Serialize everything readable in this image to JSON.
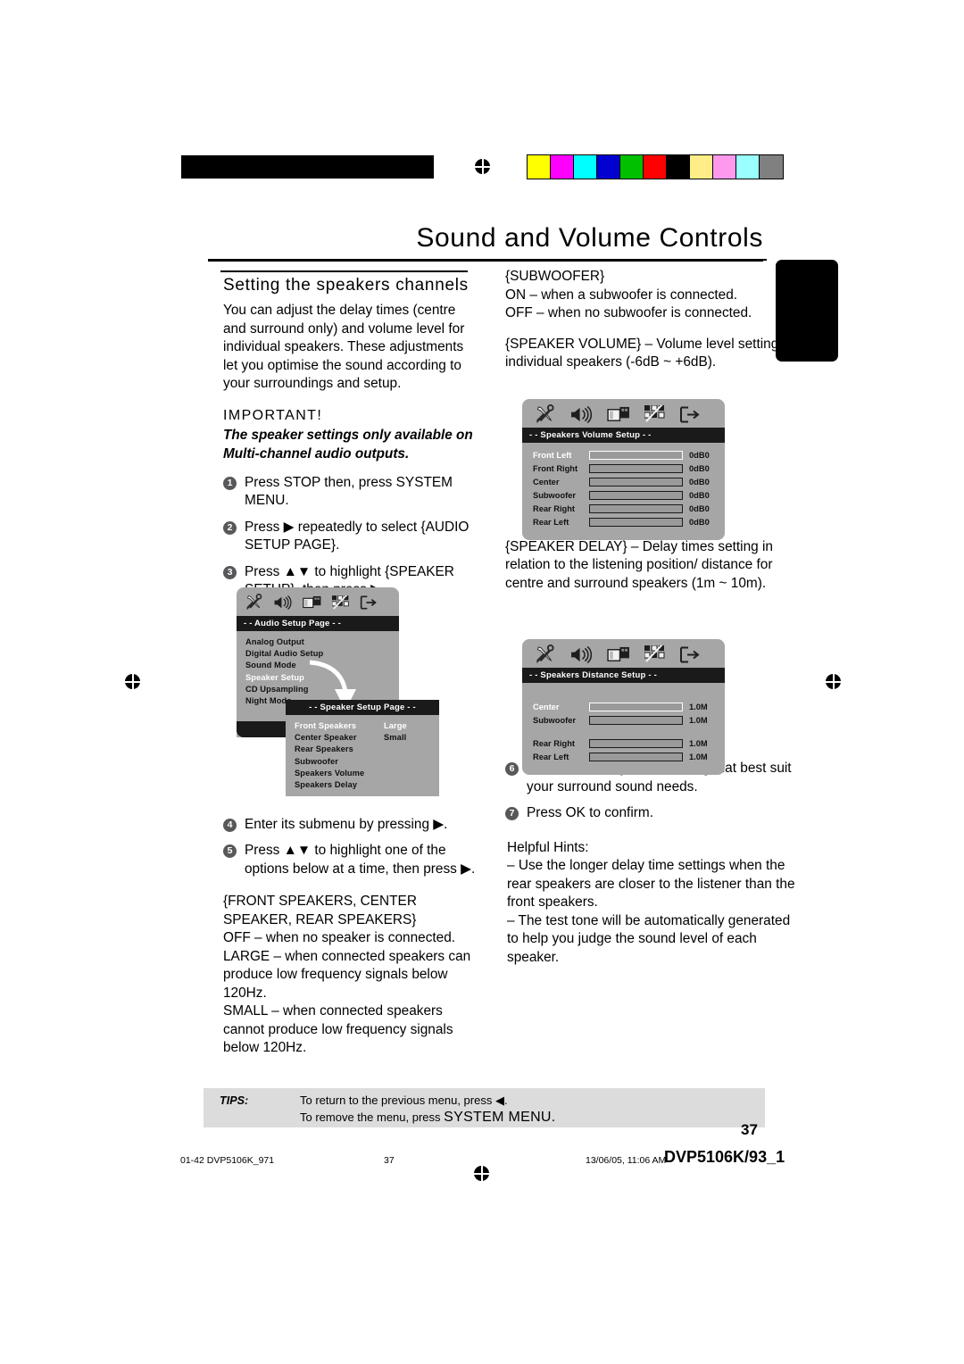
{
  "print_marks": {
    "color_bar": [
      "#ffff00",
      "#ff00ff",
      "#00ffff",
      "#0000d0",
      "#00c000",
      "#ff0000",
      "#000000",
      "#ffee88",
      "#ff99ee",
      "#99ffff",
      "#808080"
    ],
    "registration_icon": "registration-target-icon"
  },
  "header": {
    "title": "Sound and Volume Controls"
  },
  "left_column": {
    "section_heading": "Setting the speakers channels",
    "intro": "You can adjust the delay times (centre and surround only) and volume level for individual speakers. These adjustments let you optimise the sound according to your surroundings and setup.",
    "important_heading": "IMPORTANT!",
    "important_body": "The speaker settings only available on Multi-channel audio outputs.",
    "steps": [
      {
        "num": "1",
        "text": "Press STOP then, press SYSTEM MENU."
      },
      {
        "num": "2",
        "text": "Press ▶ repeatedly to select {AUDIO SETUP PAGE}."
      },
      {
        "num": "3",
        "text": "Press ▲▼ to highlight {SPEAKER SETUP}, then press ▶."
      },
      {
        "num": "4",
        "text": "Enter its submenu by pressing ▶."
      },
      {
        "num": "5",
        "text": "Press ▲▼ to highlight one of the options below at a time, then press ▶."
      }
    ],
    "speakers_heading": "{FRONT SPEAKERS, CENTER SPEAKER, REAR SPEAKERS}",
    "speakers_off": "OFF – when no speaker is connected.",
    "speakers_large": "LARGE – when connected speakers can produce low frequency signals below 120Hz.",
    "speakers_small": "SMALL – when connected speakers cannot produce low frequency signals below 120Hz."
  },
  "right_column": {
    "subwoofer_heading": "{SUBWOOFER}",
    "subwoofer_on": "ON – when a subwoofer is connected.",
    "subwoofer_off": "OFF – when no subwoofer is connected.",
    "speaker_volume": "{SPEAKER VOLUME} – Volume level setting for individual speakers (-6dB ~ +6dB).",
    "speaker_delay": "{SPEAKER DELAY} – Delay times setting in relation to the listening position/ distance for centre and surround speakers (1m ~ 10m).",
    "steps": [
      {
        "num": "6",
        "text": "Press ◀▶ to adjust the setting that best suit your surround sound needs."
      },
      {
        "num": "7",
        "text": "Press OK to confirm."
      }
    ],
    "hints_heading": "Helpful Hints:",
    "hint_1": "–    Use the longer delay time settings when the rear speakers are closer to the listener than the front speakers.",
    "hint_2": "–    The test tone will be automatically generated to help you judge the sound level of each speaker."
  },
  "osd": {
    "icons": [
      "tools-icon",
      "speaker-icon",
      "video-icon",
      "preference-icon",
      "exit-icon"
    ],
    "audio_setup": {
      "title": "- -  Audio Setup Page  - -",
      "items": [
        "Analog Output",
        "Digital Audio Setup",
        "Sound Mode",
        "Speaker Setup",
        "CD Upsampling",
        "Night Mode"
      ],
      "highlighted": "Speaker Setup"
    },
    "speaker_setup": {
      "title": "- -   Speaker Setup Page   - -",
      "items": [
        "Front Speakers",
        "Center Speaker",
        "Rear Speakers",
        "Subwoofer",
        "Speakers Volume",
        "Speakers Delay"
      ],
      "highlighted": "Front Speakers",
      "values": [
        "Large",
        "Small"
      ],
      "highlighted_value": "Large"
    },
    "volume_setup": {
      "title": "- - Speakers Volume Setup - -",
      "rows": [
        {
          "label": "Front Left",
          "fill": 48,
          "value": "0dB0",
          "highlighted": true
        },
        {
          "label": "Front Right",
          "fill": 48,
          "value": "0dB0",
          "highlighted": false
        },
        {
          "label": "Center",
          "fill": 48,
          "value": "0dB0",
          "highlighted": false
        },
        {
          "label": "Subwoofer",
          "fill": 48,
          "value": "0dB0",
          "highlighted": false
        },
        {
          "label": "Rear Right",
          "fill": 48,
          "value": "0dB0",
          "highlighted": false
        },
        {
          "label": "Rear Left",
          "fill": 48,
          "value": "0dB0",
          "highlighted": false
        }
      ]
    },
    "distance_setup": {
      "title": "- - Speakers Distance Setup - -",
      "rows": [
        {
          "label": "Center",
          "fill": 0,
          "value": "1.0M",
          "highlighted": true
        },
        {
          "label": "Subwoofer",
          "fill": 0,
          "value": "1.0M",
          "highlighted": false
        },
        {
          "label": "Rear Right",
          "fill": 0,
          "value": "1.0M",
          "highlighted": false
        },
        {
          "label": "Rear Left",
          "fill": 0,
          "value": "1.0M",
          "highlighted": false
        }
      ]
    }
  },
  "tips": {
    "label": "TIPS:",
    "line1": "To return to the previous menu, press ◀.",
    "line2_prefix": "To remove the menu, press ",
    "line2_bold": "SYSTEM MENU."
  },
  "page_number": "37",
  "printer_footer": {
    "left": "01-42 DVP5106K_971",
    "center": "37",
    "date": "13/06/05, 11:06 AM",
    "doc": "DVP5106K/93_1"
  }
}
